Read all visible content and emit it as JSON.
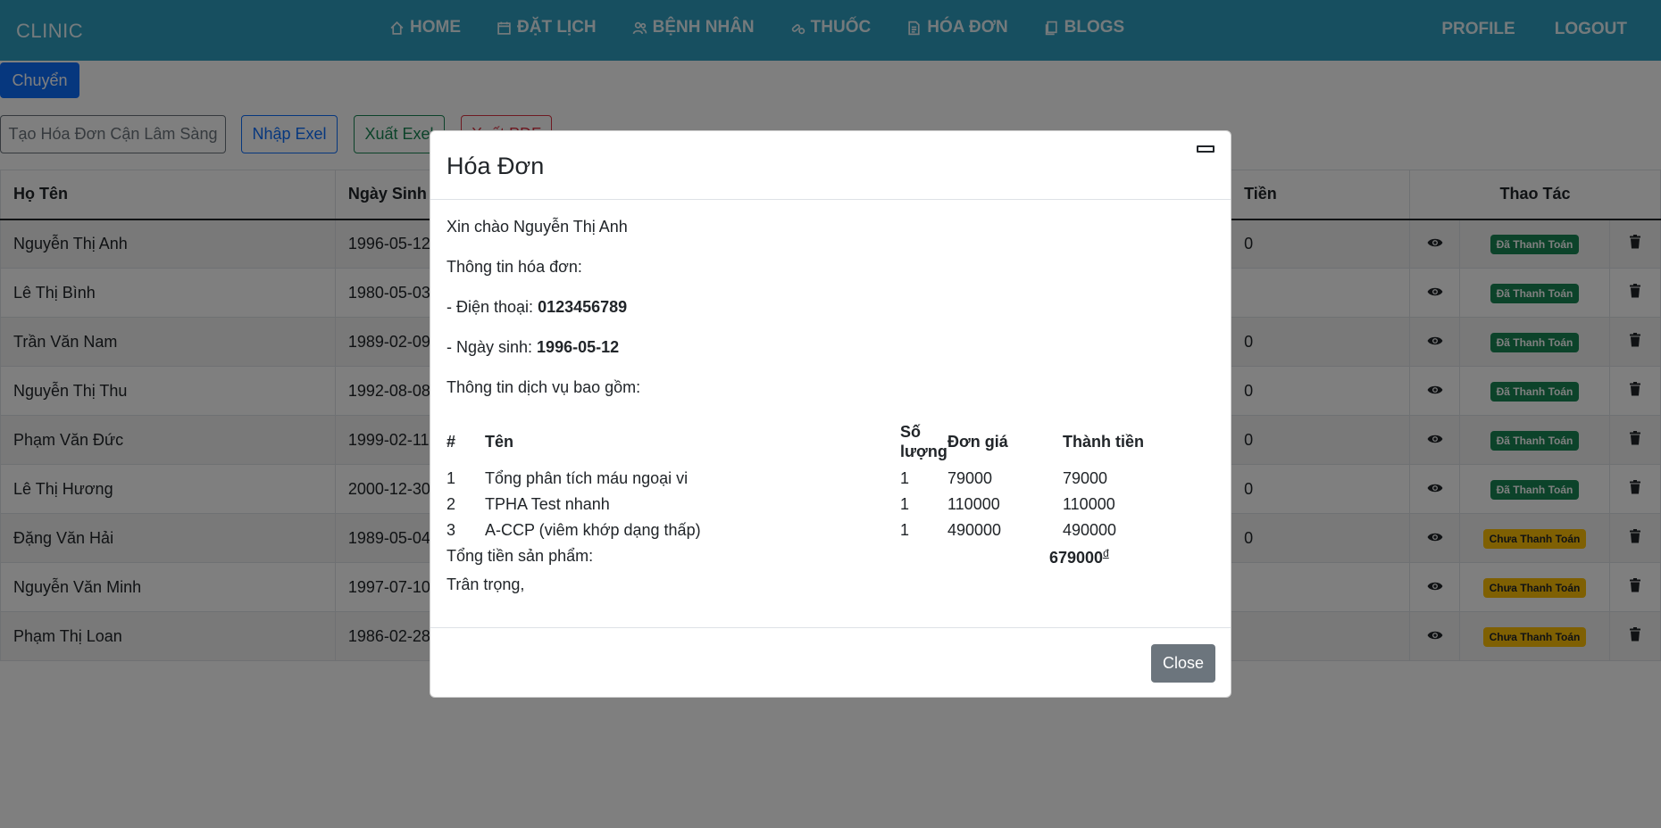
{
  "navbar": {
    "brand": "CLINIC",
    "items": [
      {
        "label": "HOME",
        "icon": "home-icon"
      },
      {
        "label": "ĐẶT LỊCH",
        "icon": "calendar-icon"
      },
      {
        "label": "BỆNH NHÂN",
        "icon": "people-icon"
      },
      {
        "label": "THUỐC",
        "icon": "pill-icon"
      },
      {
        "label": "HÓA ĐƠN",
        "icon": "document-icon"
      },
      {
        "label": "BLOGS",
        "icon": "copy-icon"
      }
    ],
    "profile": "PROFILE",
    "logout": "LOGOUT"
  },
  "toolbar": {
    "chuyen": "Chuyển",
    "create_invoice": "Tạo Hóa Đơn Cận Lâm Sàng",
    "import_excel": "Nhập Exel",
    "export_excel": "Xuất Exel",
    "export_pdf": "Xuất PDF"
  },
  "table": {
    "headers": {
      "name": "Họ Tên",
      "dob": "Ngày Sinh",
      "money": "Tiền",
      "actions": "Thao Tác"
    },
    "rows": [
      {
        "name": "Nguyễn Thị Anh",
        "dob": "1996-05-12",
        "money": "0",
        "status": "Đã Thanh Toán",
        "paid": true
      },
      {
        "name": "Lê Thị Bình",
        "dob": "1980-05-03",
        "money": "",
        "status": "Đã Thanh Toán",
        "paid": true
      },
      {
        "name": "Trần Văn Nam",
        "dob": "1989-02-09",
        "money": "0",
        "status": "Đã Thanh Toán",
        "paid": true
      },
      {
        "name": "Nguyễn Thị Thu",
        "dob": "1992-08-08",
        "money": "0",
        "status": "Đã Thanh Toán",
        "paid": true
      },
      {
        "name": "Phạm Văn Đức",
        "dob": "1999-02-11",
        "money": "0",
        "status": "Đã Thanh Toán",
        "paid": true
      },
      {
        "name": "Lê Thị Hương",
        "dob": "2000-12-30",
        "money": "0",
        "status": "Đã Thanh Toán",
        "paid": true
      },
      {
        "name": "Đặng Văn Hải",
        "dob": "1989-05-04",
        "money": "0",
        "status": "Chưa Thanh Toán",
        "paid": false
      },
      {
        "name": "Nguyễn Văn Minh",
        "dob": "1997-07-10",
        "money": "",
        "status": "Chưa Thanh Toán",
        "paid": false
      },
      {
        "name": "Phạm Thị Loan",
        "dob": "1986-02-28",
        "money": "",
        "status": "Chưa Thanh Toán",
        "paid": false
      }
    ]
  },
  "modal": {
    "title": "Hóa Đơn",
    "greeting": "Xin chào Nguyễn Thị Anh",
    "info_heading": "Thông tin hóa đơn:",
    "phone_label": "- Điện thoại: ",
    "phone": "0123456789",
    "dob_label": "- Ngày sinh: ",
    "dob": "1996-05-12",
    "services_heading": "Thông tin dịch vụ bao gồm:",
    "columns": {
      "no": "#",
      "name": "Tên",
      "qty": "Số lượng",
      "price": "Đơn giá",
      "total": "Thành tiền"
    },
    "items": [
      {
        "no": "1",
        "name": "Tổng phân tích máu ngoại vi",
        "qty": "1",
        "price": "79000",
        "total": "79000"
      },
      {
        "no": "2",
        "name": "TPHA Test nhanh",
        "qty": "1",
        "price": "110000",
        "total": "110000"
      },
      {
        "no": "3",
        "name": "A-CCP (viêm khớp dạng thấp)",
        "qty": "1",
        "price": "490000",
        "total": "490000"
      }
    ],
    "total_label": "Tổng tiền sản phẩm:",
    "total_value": "679000",
    "currency": "đ",
    "regards": "Trân trọng,",
    "close_button": "Close"
  }
}
